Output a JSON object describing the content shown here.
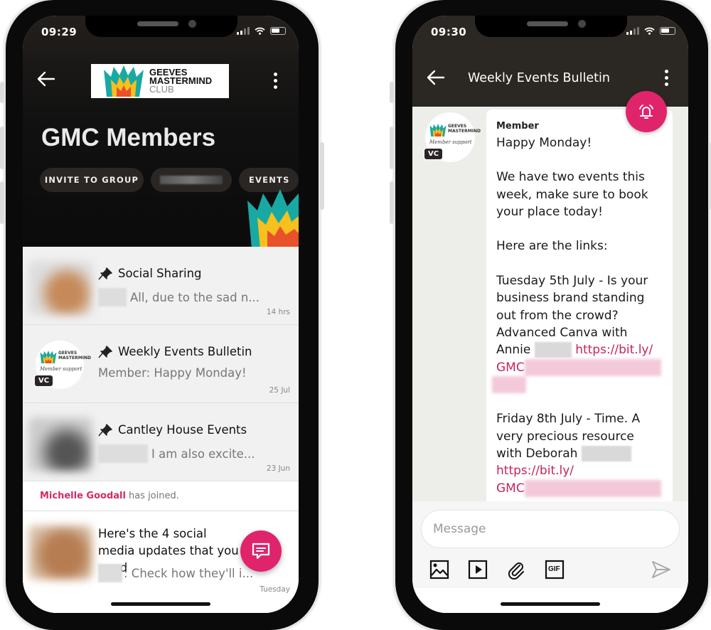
{
  "left_phone": {
    "status_time": "09:29",
    "header": {
      "logo_lines": [
        "GEEVES",
        "MASTERMIND",
        "CLUB"
      ],
      "group_title": "GMC Members",
      "chips": [
        {
          "label": "INVITE TO GROUP"
        },
        {
          "label": ""
        },
        {
          "label": "EVENTS"
        }
      ]
    },
    "chats": [
      {
        "title": "Social Sharing",
        "pinned": true,
        "preview": "All, due to the sad n...",
        "time": "14 hrs"
      },
      {
        "title": "Weekly Events Bulletin",
        "pinned": true,
        "preview": "Member: Happy Monday!",
        "time": "25 Jul",
        "avatar_badge": "VC",
        "avatar_caption": "Member support"
      },
      {
        "title": "Cantley House Events",
        "pinned": true,
        "preview": "I am also excite...",
        "time": "23 Jun"
      }
    ],
    "system_message": {
      "name": "Michelle Goodall",
      "text": "has joined."
    },
    "latest_post": {
      "title": "Here's the 4 social media updates that you need",
      "preview": ": Check how they'll i...",
      "time": "Tuesday"
    },
    "fab_icon": "chat-bubble-icon"
  },
  "right_phone": {
    "status_time": "09:30",
    "header": {
      "title": "Weekly Events Bulletin"
    },
    "message": {
      "avatar_badge": "VC",
      "sender": "Member",
      "paragraphs": [
        "Happy Monday!",
        "We have two events this week, make sure to book your place today!",
        "Here are the links:"
      ],
      "event1_text": "Tuesday 5th July - Is your business brand standing out from the crowd? Advanced Canva with Annie",
      "event1_link_start": "https://bit.ly/",
      "event1_link_prefix": "GMC",
      "event2_text": "Friday 8th July - Time. A very precious resource with Deborah",
      "event2_link_start": "https://bit.ly/",
      "event2_link_prefix": "GMC"
    },
    "composer": {
      "placeholder": "Message",
      "tools": [
        "image-icon",
        "video-icon",
        "attachment-icon",
        "gif-icon"
      ],
      "gif_label": "GIF"
    }
  },
  "colors": {
    "accent": "#e0246c",
    "link": "#c4245f",
    "header_dark": "#2b2723"
  }
}
